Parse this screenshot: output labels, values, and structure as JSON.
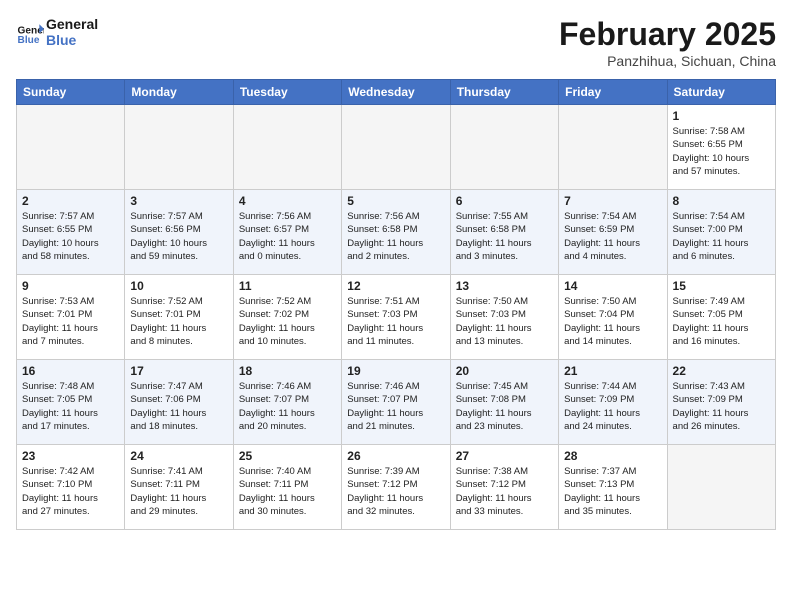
{
  "header": {
    "logo_general": "General",
    "logo_blue": "Blue",
    "month_title": "February 2025",
    "subtitle": "Panzhihua, Sichuan, China"
  },
  "weekdays": [
    "Sunday",
    "Monday",
    "Tuesday",
    "Wednesday",
    "Thursday",
    "Friday",
    "Saturday"
  ],
  "weeks": [
    [
      {
        "day": "",
        "info": ""
      },
      {
        "day": "",
        "info": ""
      },
      {
        "day": "",
        "info": ""
      },
      {
        "day": "",
        "info": ""
      },
      {
        "day": "",
        "info": ""
      },
      {
        "day": "",
        "info": ""
      },
      {
        "day": "1",
        "info": "Sunrise: 7:58 AM\nSunset: 6:55 PM\nDaylight: 10 hours\nand 57 minutes."
      }
    ],
    [
      {
        "day": "2",
        "info": "Sunrise: 7:57 AM\nSunset: 6:55 PM\nDaylight: 10 hours\nand 58 minutes."
      },
      {
        "day": "3",
        "info": "Sunrise: 7:57 AM\nSunset: 6:56 PM\nDaylight: 10 hours\nand 59 minutes."
      },
      {
        "day": "4",
        "info": "Sunrise: 7:56 AM\nSunset: 6:57 PM\nDaylight: 11 hours\nand 0 minutes."
      },
      {
        "day": "5",
        "info": "Sunrise: 7:56 AM\nSunset: 6:58 PM\nDaylight: 11 hours\nand 2 minutes."
      },
      {
        "day": "6",
        "info": "Sunrise: 7:55 AM\nSunset: 6:58 PM\nDaylight: 11 hours\nand 3 minutes."
      },
      {
        "day": "7",
        "info": "Sunrise: 7:54 AM\nSunset: 6:59 PM\nDaylight: 11 hours\nand 4 minutes."
      },
      {
        "day": "8",
        "info": "Sunrise: 7:54 AM\nSunset: 7:00 PM\nDaylight: 11 hours\nand 6 minutes."
      }
    ],
    [
      {
        "day": "9",
        "info": "Sunrise: 7:53 AM\nSunset: 7:01 PM\nDaylight: 11 hours\nand 7 minutes."
      },
      {
        "day": "10",
        "info": "Sunrise: 7:52 AM\nSunset: 7:01 PM\nDaylight: 11 hours\nand 8 minutes."
      },
      {
        "day": "11",
        "info": "Sunrise: 7:52 AM\nSunset: 7:02 PM\nDaylight: 11 hours\nand 10 minutes."
      },
      {
        "day": "12",
        "info": "Sunrise: 7:51 AM\nSunset: 7:03 PM\nDaylight: 11 hours\nand 11 minutes."
      },
      {
        "day": "13",
        "info": "Sunrise: 7:50 AM\nSunset: 7:03 PM\nDaylight: 11 hours\nand 13 minutes."
      },
      {
        "day": "14",
        "info": "Sunrise: 7:50 AM\nSunset: 7:04 PM\nDaylight: 11 hours\nand 14 minutes."
      },
      {
        "day": "15",
        "info": "Sunrise: 7:49 AM\nSunset: 7:05 PM\nDaylight: 11 hours\nand 16 minutes."
      }
    ],
    [
      {
        "day": "16",
        "info": "Sunrise: 7:48 AM\nSunset: 7:05 PM\nDaylight: 11 hours\nand 17 minutes."
      },
      {
        "day": "17",
        "info": "Sunrise: 7:47 AM\nSunset: 7:06 PM\nDaylight: 11 hours\nand 18 minutes."
      },
      {
        "day": "18",
        "info": "Sunrise: 7:46 AM\nSunset: 7:07 PM\nDaylight: 11 hours\nand 20 minutes."
      },
      {
        "day": "19",
        "info": "Sunrise: 7:46 AM\nSunset: 7:07 PM\nDaylight: 11 hours\nand 21 minutes."
      },
      {
        "day": "20",
        "info": "Sunrise: 7:45 AM\nSunset: 7:08 PM\nDaylight: 11 hours\nand 23 minutes."
      },
      {
        "day": "21",
        "info": "Sunrise: 7:44 AM\nSunset: 7:09 PM\nDaylight: 11 hours\nand 24 minutes."
      },
      {
        "day": "22",
        "info": "Sunrise: 7:43 AM\nSunset: 7:09 PM\nDaylight: 11 hours\nand 26 minutes."
      }
    ],
    [
      {
        "day": "23",
        "info": "Sunrise: 7:42 AM\nSunset: 7:10 PM\nDaylight: 11 hours\nand 27 minutes."
      },
      {
        "day": "24",
        "info": "Sunrise: 7:41 AM\nSunset: 7:11 PM\nDaylight: 11 hours\nand 29 minutes."
      },
      {
        "day": "25",
        "info": "Sunrise: 7:40 AM\nSunset: 7:11 PM\nDaylight: 11 hours\nand 30 minutes."
      },
      {
        "day": "26",
        "info": "Sunrise: 7:39 AM\nSunset: 7:12 PM\nDaylight: 11 hours\nand 32 minutes."
      },
      {
        "day": "27",
        "info": "Sunrise: 7:38 AM\nSunset: 7:12 PM\nDaylight: 11 hours\nand 33 minutes."
      },
      {
        "day": "28",
        "info": "Sunrise: 7:37 AM\nSunset: 7:13 PM\nDaylight: 11 hours\nand 35 minutes."
      },
      {
        "day": "",
        "info": ""
      }
    ]
  ]
}
